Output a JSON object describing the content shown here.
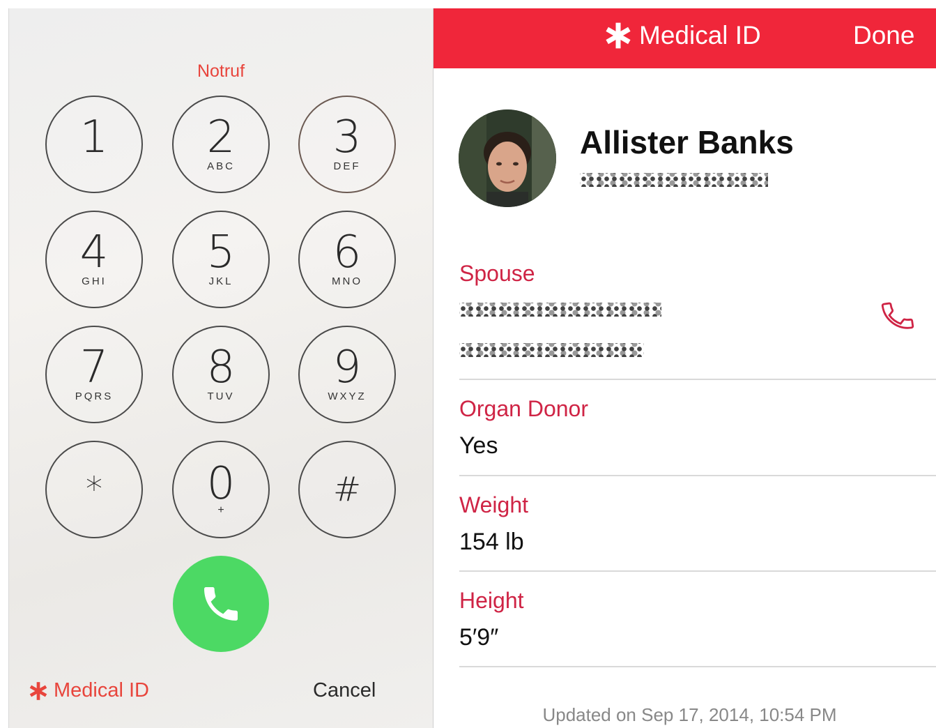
{
  "dialer": {
    "title": "Notruf",
    "keys": [
      {
        "digit": "1",
        "letters": ""
      },
      {
        "digit": "2",
        "letters": "ABC"
      },
      {
        "digit": "3",
        "letters": "DEF"
      },
      {
        "digit": "4",
        "letters": "GHI"
      },
      {
        "digit": "5",
        "letters": "JKL"
      },
      {
        "digit": "6",
        "letters": "MNO"
      },
      {
        "digit": "7",
        "letters": "PQRS"
      },
      {
        "digit": "8",
        "letters": "TUV"
      },
      {
        "digit": "9",
        "letters": "WXYZ"
      },
      {
        "digit": "*",
        "letters": ""
      },
      {
        "digit": "0",
        "letters": "+"
      },
      {
        "digit": "#",
        "letters": ""
      }
    ],
    "call_icon": "phone-icon",
    "medical_id_label": "Medical ID",
    "cancel_label": "Cancel"
  },
  "medical_id": {
    "header_title": "Medical ID",
    "done_label": "Done",
    "name": "Allister Banks",
    "fields": [
      {
        "label": "Spouse",
        "value": ""
      },
      {
        "label": "Organ Donor",
        "value": "Yes"
      },
      {
        "label": "Weight",
        "value": "154 lb"
      },
      {
        "label": "Height",
        "value": "5′9″"
      }
    ],
    "updated": "Updated on Sep 17, 2014, 10:54 PM"
  },
  "colors": {
    "accent_red": "#f0263a",
    "label_red": "#cf2445",
    "call_green": "#4cd964"
  }
}
